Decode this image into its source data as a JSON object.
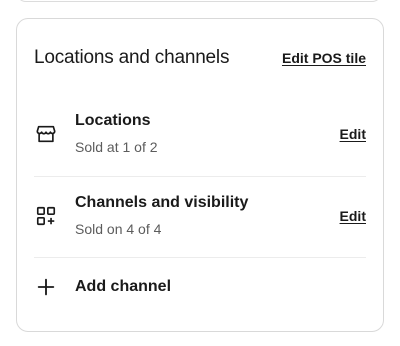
{
  "card": {
    "title": "Locations and channels",
    "edit_pos_tile_label": "Edit POS tile"
  },
  "locations": {
    "icon": "store-icon",
    "title": "Locations",
    "subtitle": "Sold at 1 of 2",
    "edit_label": "Edit"
  },
  "channels": {
    "icon": "apps-add-icon",
    "title": "Channels and visibility",
    "subtitle": "Sold on 4 of 4",
    "edit_label": "Edit"
  },
  "add_channel": {
    "icon": "plus-icon",
    "label": "Add channel"
  }
}
